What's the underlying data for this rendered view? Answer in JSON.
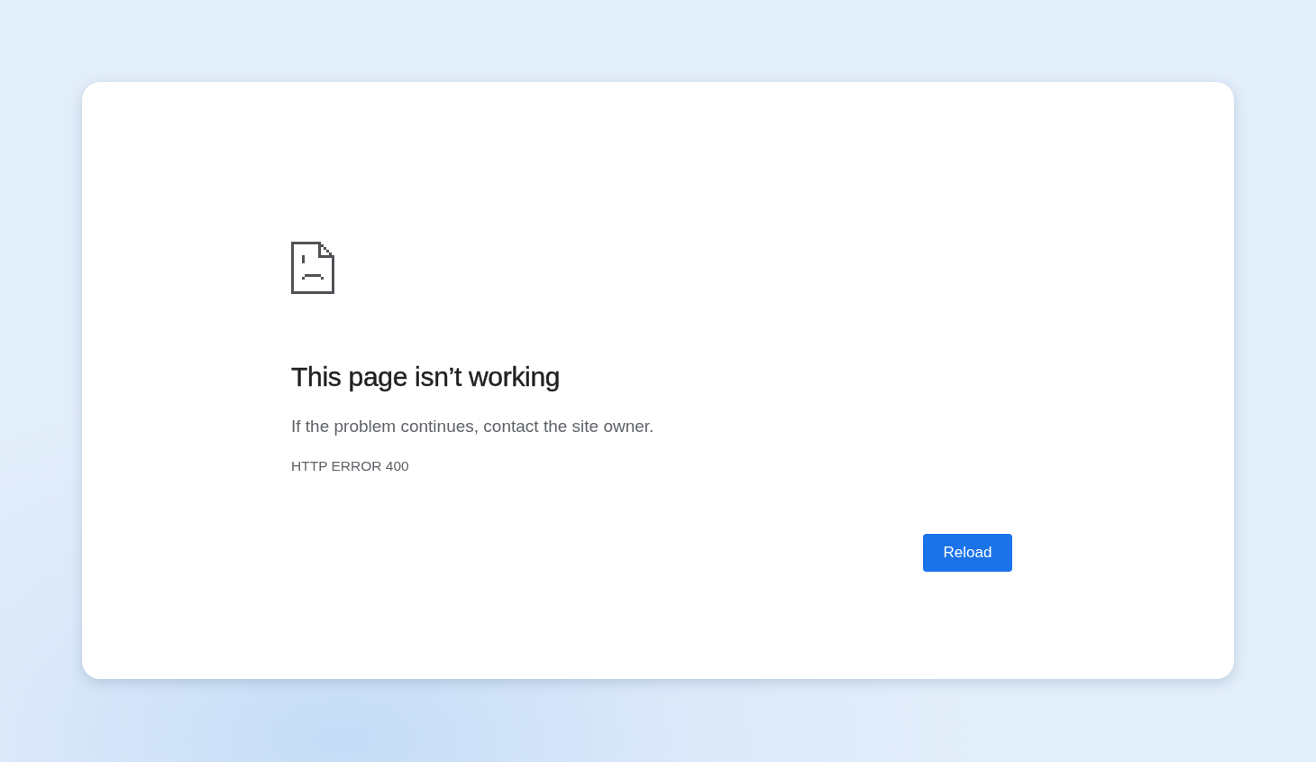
{
  "error_page": {
    "title": "This page isn’t working",
    "message": "If the problem continues, contact the site owner.",
    "error_code": "HTTP ERROR 400",
    "buttons": [
      "Reload"
    ]
  }
}
